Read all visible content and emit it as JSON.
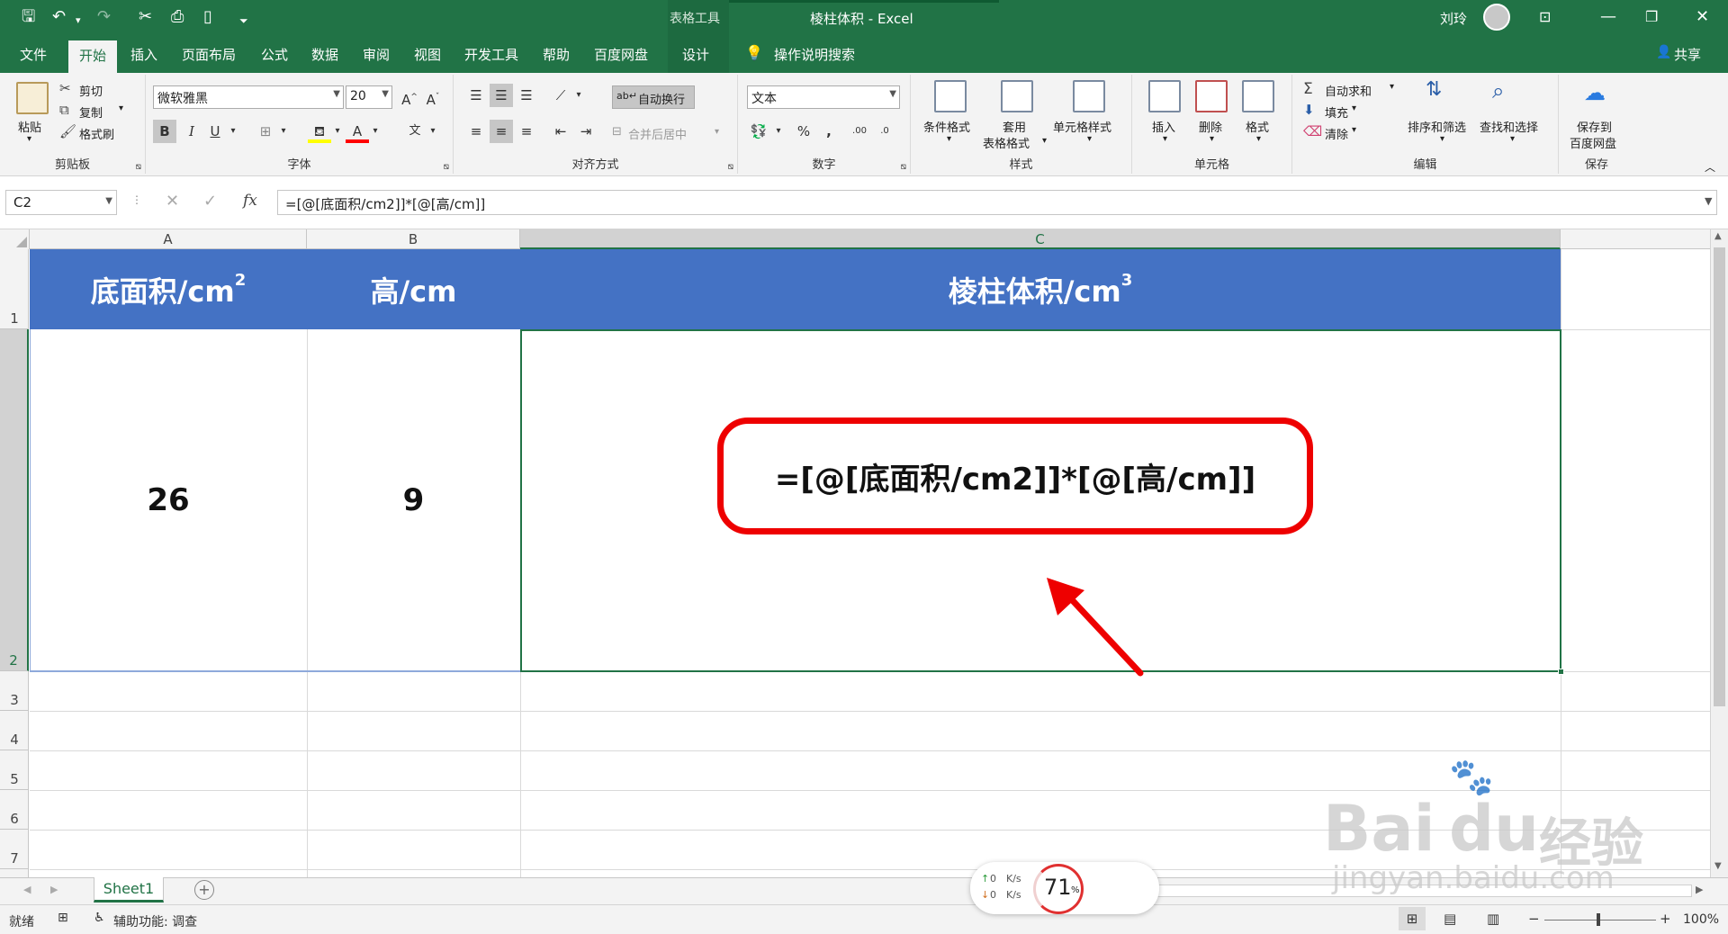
{
  "window": {
    "title": "棱柱体积 - Excel",
    "context_tool": "表格工具",
    "user": "刘玲",
    "controls": [
      "minimize",
      "restore",
      "close"
    ]
  },
  "quick_access": [
    "save-icon",
    "undo-icon",
    "redo-icon",
    "cut-icon",
    "save-as-icon",
    "new-icon",
    "customize-icon"
  ],
  "tabs": [
    {
      "label": "文件"
    },
    {
      "label": "开始"
    },
    {
      "label": "插入"
    },
    {
      "label": "页面布局"
    },
    {
      "label": "公式"
    },
    {
      "label": "数据"
    },
    {
      "label": "审阅"
    },
    {
      "label": "视图"
    },
    {
      "label": "开发工具"
    },
    {
      "label": "帮助"
    },
    {
      "label": "百度网盘"
    },
    {
      "label": "设计"
    }
  ],
  "active_tab": "开始",
  "tell_me": "操作说明搜索",
  "share": "共享",
  "ribbon": {
    "clipboard": {
      "label": "剪贴板",
      "paste": "粘贴",
      "cut": "剪切",
      "copy": "复制",
      "painter": "格式刷"
    },
    "font": {
      "label": "字体",
      "name": "微软雅黑",
      "size": "20"
    },
    "alignment": {
      "label": "对齐方式",
      "wrap": "自动换行",
      "merge": "合并后居中"
    },
    "number": {
      "label": "数字",
      "format": "文本"
    },
    "styles": {
      "label": "样式",
      "cond": "条件格式",
      "table1": "套用",
      "table2": "表格格式",
      "cell": "单元格样式"
    },
    "cells": {
      "label": "单元格",
      "insert": "插入",
      "delete": "删除",
      "format": "格式"
    },
    "editing": {
      "label": "编辑",
      "autosum": "自动求和",
      "fill": "填充",
      "clear": "清除",
      "sort": "排序和筛选",
      "find": "查找和选择"
    },
    "save": {
      "label": "保存",
      "btn1": "保存到",
      "btn2": "百度网盘"
    }
  },
  "formula_bar": {
    "name_box": "C2",
    "fx": "fx",
    "formula": "=[@[底面积/cm2]]*[@[高/cm]]"
  },
  "sheet": {
    "columns": [
      "A",
      "B",
      "C"
    ],
    "rows": [
      "1",
      "2",
      "3",
      "4",
      "5",
      "6",
      "7"
    ],
    "header": {
      "a_text": "底面积/cm",
      "a_sup": "2",
      "b_text": "高/cm",
      "c_text": "棱柱体积/cm",
      "c_sup": "3"
    },
    "row2": {
      "a": "26",
      "b": "9"
    },
    "callout_formula": "=[@[底面积/cm2]]*[@[高/cm]]",
    "header_color": "#4472c4",
    "callout_color": "#ee0000"
  },
  "sheet_tabs": [
    {
      "label": "Sheet1"
    }
  ],
  "status": {
    "ready": "就绪",
    "accessibility": "辅助功能: 调查",
    "zoom": "100%"
  },
  "net_widget": {
    "up": "0",
    "down": "0",
    "unit": "K/s",
    "cpu": "71",
    "pct": "%"
  },
  "watermark": {
    "brand": "Bai",
    "brand2": "du",
    "cn": "经验",
    "url": "jingyan.baidu.com"
  }
}
